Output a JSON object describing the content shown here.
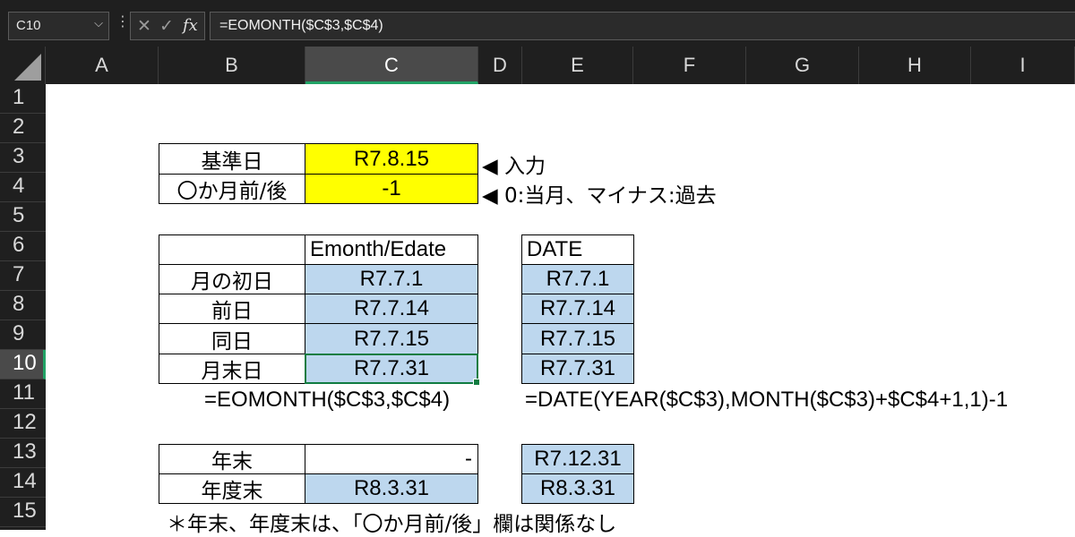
{
  "formula_bar": {
    "name_box": "C10",
    "cancel_icon": "close-icon",
    "confirm_icon": "check-icon",
    "fx_label": "fx",
    "formula": "=EOMONTH($C$3,$C$4)"
  },
  "columns": [
    "A",
    "B",
    "C",
    "D",
    "E",
    "F",
    "G",
    "H",
    "I"
  ],
  "selected_column": "C",
  "rows": [
    "1",
    "2",
    "3",
    "4",
    "5",
    "6",
    "7",
    "8",
    "9",
    "10",
    "11",
    "12",
    "13",
    "14",
    "15"
  ],
  "selected_row": "10",
  "inputs": {
    "base_date_label": "基準日",
    "base_date_value": "R7.8.15",
    "base_date_note": "◀ 入力",
    "offset_label": "〇か月前/後",
    "offset_value": "-1",
    "offset_note": "◀ 0:当月、マイナス:過去"
  },
  "table1": {
    "header": "Emonth/Edate",
    "rows": [
      {
        "label": "月の初日",
        "value": "R7.7.1"
      },
      {
        "label": "前日",
        "value": "R7.7.14"
      },
      {
        "label": "同日",
        "value": "R7.7.15"
      },
      {
        "label": "月末日",
        "value": "R7.7.31"
      }
    ],
    "formula_note": "=EOMONTH($C$3,$C$4)"
  },
  "table2": {
    "header": "DATE",
    "values": [
      "R7.7.1",
      "R7.7.14",
      "R7.7.15",
      "R7.7.31"
    ],
    "formula_note": "=DATE(YEAR($C$3),MONTH($C$3)+$C$4+1,1)-1"
  },
  "table3": {
    "rows": [
      {
        "label": "年末",
        "value": "-",
        "date_value": "R7.12.31"
      },
      {
        "label": "年度末",
        "value": "R8.3.31",
        "date_value": "R8.3.31"
      }
    ],
    "footnote": "＊年末、年度末は、「〇か月前/後」欄は関係なし"
  }
}
